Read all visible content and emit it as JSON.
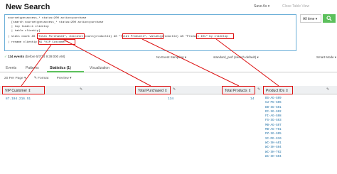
{
  "header": {
    "title": "New Search",
    "save_as": "Save As ▾",
    "close_table": "Close Table View"
  },
  "search": {
    "lines": [
      "sourcetype=access_* status=200 action=purchase",
      "  [search sourcetype=access_* status=200 action=purchase",
      "  | top limit=1 clientip",
      "  | table clientip]",
      "| stats count AS \"Total Purchased\", distinct_count(productId) AS \"Total Products\", values(productId) AS \"Product IDs\" by clientip",
      "| rename clientip AS \"VIP Customer\""
    ],
    "time_picker": "All time ▾"
  },
  "status": {
    "events": "134 events",
    "range": "(before 5/7/14 9:39:000 AM)",
    "sampling": "No Event Sampling ▾",
    "job": "Job ▾",
    "mode": "Smart Mode ▾",
    "perf": "standard_perf (search default) ▾"
  },
  "tabs": [
    "Events",
    "Patterns",
    "Statistics (1)",
    "Visualization"
  ],
  "toolbar": {
    "per_page": "20 Per Page ▾",
    "format": "✎ Format",
    "preview": "Preview ▾"
  },
  "table": {
    "headers": [
      "VIP Customer ⇕",
      "Total Purchased ⇕",
      "Total Products ⇕",
      "Product IDs ⇕"
    ],
    "row": {
      "vip_customer": "87.194.216.51",
      "total_purchased": "134",
      "total_products": "14",
      "product_ids": [
        "BS-AG-G09",
        "CU-PG-G06",
        "DB-SG-G01",
        "DC-SG-G02",
        "FI-AG-G08",
        "FS-SG-G03",
        "MB-AG-G07",
        "MB-AG-T01",
        "PZ-SG-G05",
        "SC-MG-G10",
        "WC-SH-A01",
        "WC-SH-G04",
        "WC-SH-T02",
        "WC-SH-G04"
      ]
    }
  },
  "accent": "#5cc05c",
  "annotation_color": "#dd1111"
}
